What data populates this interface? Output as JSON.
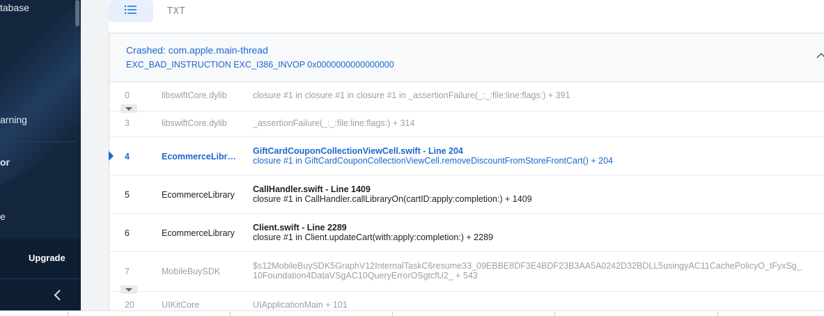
{
  "sidebar": {
    "items": [
      {
        "label": "tabase"
      },
      {
        "label": "arning"
      },
      {
        "label": "or"
      },
      {
        "label": "e"
      }
    ],
    "upgrade_label": "Upgrade",
    "collapse_icon": "chevron-left-icon"
  },
  "toolbar": {
    "list_view_icon": "list-icon",
    "txt_label": "TXT"
  },
  "crash": {
    "title": "Crashed: com.apple.main-thread",
    "exception": "EXC_BAD_INSTRUCTION EXC_I386_INVOP 0x0000000000000000",
    "collapse_icon": "chevron-up-icon"
  },
  "frames": [
    {
      "num": "0",
      "lib": "libswiftCore.dylib",
      "line1": "",
      "line2": "closure #1 in closure #1 in closure #1 in _assertionFailure(_:_:file:line:flags:) + 391",
      "style": "muted"
    },
    {
      "num": "3",
      "lib": "libswiftCore.dylib",
      "line1": "",
      "line2": "_assertionFailure(_:_:file:line:flags:) + 314",
      "style": "muted"
    },
    {
      "num": "4",
      "lib": "EcommerceLibrary",
      "line1": "GiftCardCouponCollectionViewCell.swift - Line 204",
      "line2": "closure #1 in GiftCardCouponCollectionViewCell.removeDiscountFromStoreFrontCart() + 204",
      "style": "blue"
    },
    {
      "num": "5",
      "lib": "EcommerceLibrary",
      "line1": "CallHandler.swift - Line 1409",
      "line2": "closure #1 in CallHandler.callLibraryOn(cartID:apply:completion:) + 1409",
      "style": "dark"
    },
    {
      "num": "6",
      "lib": "EcommerceLibrary",
      "line1": "Client.swift - Line 2289",
      "line2": "closure #1 in Client.updateCart(with:apply:completion:) + 2289",
      "style": "dark"
    },
    {
      "num": "7",
      "lib": "MobileBuySDK",
      "line1": "",
      "line2": "$s12MobileBuySDK5GraphV12InternalTaskC6resume33_09EBBE8DF3E4BDF23B3AA5A0242D32BDLL5usingyAC11CachePolicyO_tFyxSg_",
      "line3": "10Foundation4DataVSgAC10QueryErrorOSgtcfU2_ + 543",
      "style": "muted"
    },
    {
      "num": "20",
      "lib": "UIKitCore",
      "line1": "",
      "line2": "UIApplicationMain + 101",
      "style": "muted"
    }
  ],
  "colors": {
    "sidebar_bg": "#14263d",
    "accent_blue": "#1967d2",
    "muted_text": "#9aa0a6"
  }
}
